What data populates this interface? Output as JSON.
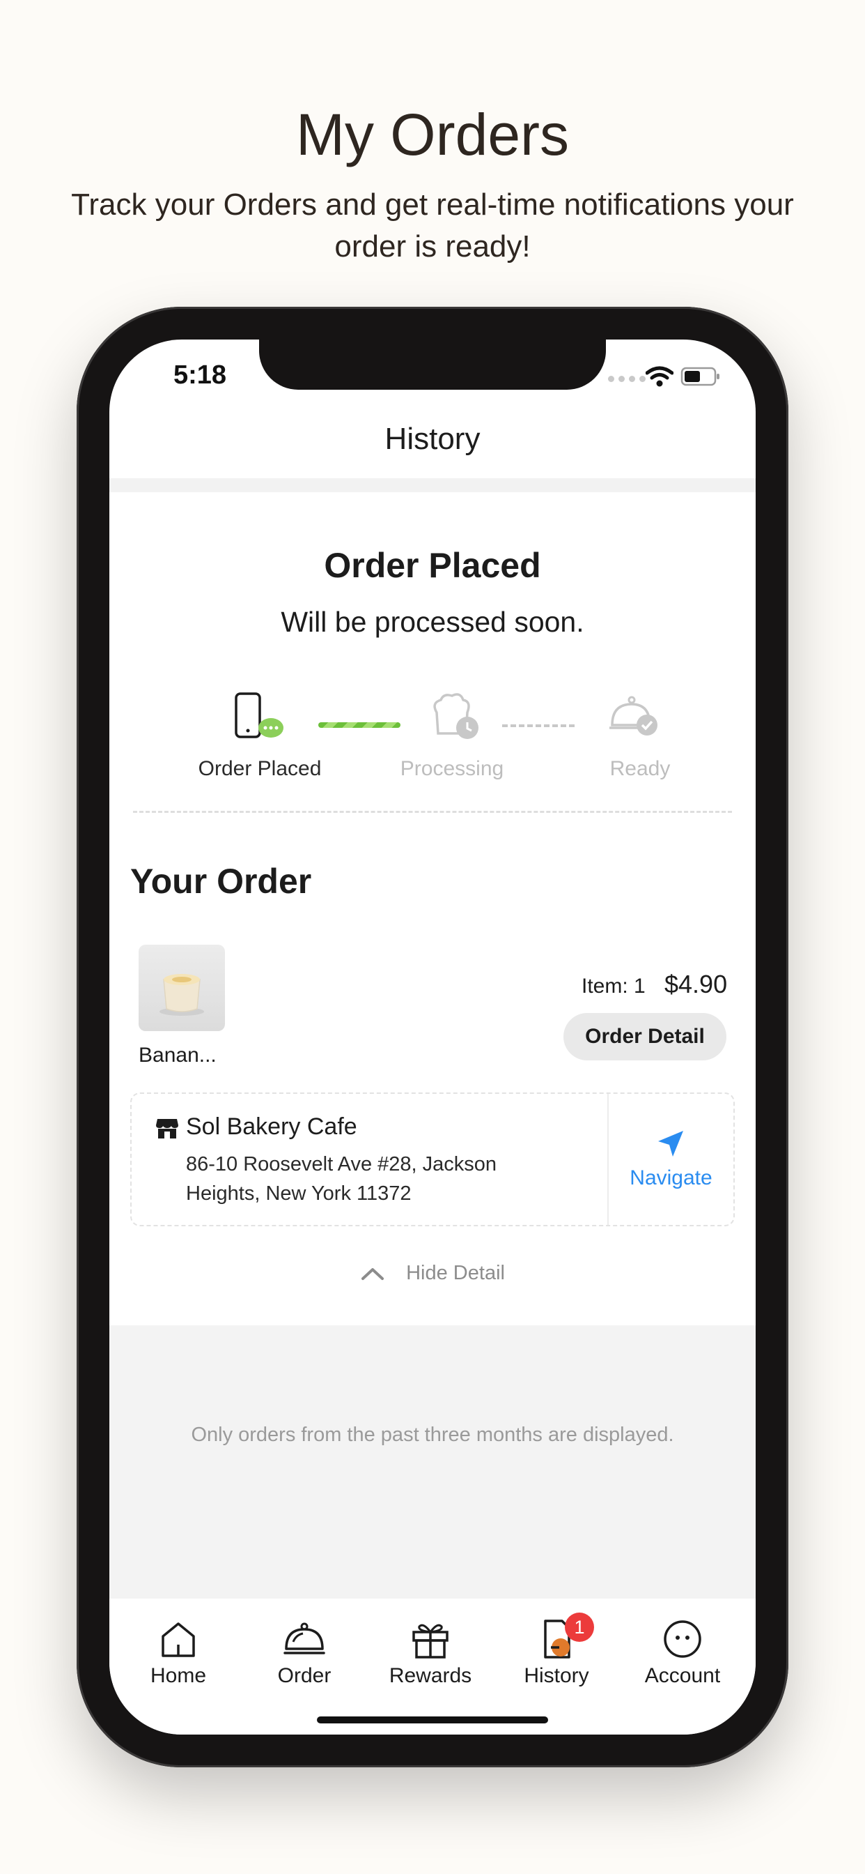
{
  "promo": {
    "title": "My Orders",
    "subtitle": "Track your Orders and get real-time notifications your order is ready!"
  },
  "status_bar": {
    "time": "5:18",
    "icons": [
      "signal-icon",
      "wifi-icon",
      "battery-icon"
    ]
  },
  "header": {
    "title": "History"
  },
  "order_status": {
    "heading": "Order Placed",
    "subheading": "Will be processed soon.",
    "steps": [
      {
        "label": "Order Placed",
        "icon": "phone-chat-icon",
        "state": "active"
      },
      {
        "label": "Processing",
        "icon": "chef-clock-icon",
        "state": "inactive"
      },
      {
        "label": "Ready",
        "icon": "cloche-check-icon",
        "state": "inactive"
      }
    ]
  },
  "your_order": {
    "title": "Your Order",
    "item": {
      "name": "Banan...",
      "count_label": "Item: 1",
      "price": "$4.90"
    },
    "order_detail_label": "Order Detail"
  },
  "store": {
    "icon": "storefront-icon",
    "name": "Sol Bakery Cafe",
    "address": "86-10 Roosevelt Ave #28, Jackson Heights, New York 11372",
    "navigate_label": "Navigate",
    "navigate_icon": "navigation-arrow-icon"
  },
  "hide_detail_label": "Hide Detail",
  "notice": "Only orders from the past three months are displayed.",
  "tabbar": {
    "items": [
      {
        "label": "Home",
        "icon": "home-icon"
      },
      {
        "label": "Order",
        "icon": "cloche-icon"
      },
      {
        "label": "Rewards",
        "icon": "gift-icon"
      },
      {
        "label": "History",
        "icon": "history-document-icon",
        "badge": "1"
      },
      {
        "label": "Account",
        "icon": "smiley-account-icon"
      }
    ]
  },
  "colors": {
    "background": "#fdfbf7",
    "accent_blue": "#2a8cf0",
    "progress_green": "#6cbf3a",
    "badge_red": "#ec3b3b",
    "history_accent": "#e07a2b"
  }
}
